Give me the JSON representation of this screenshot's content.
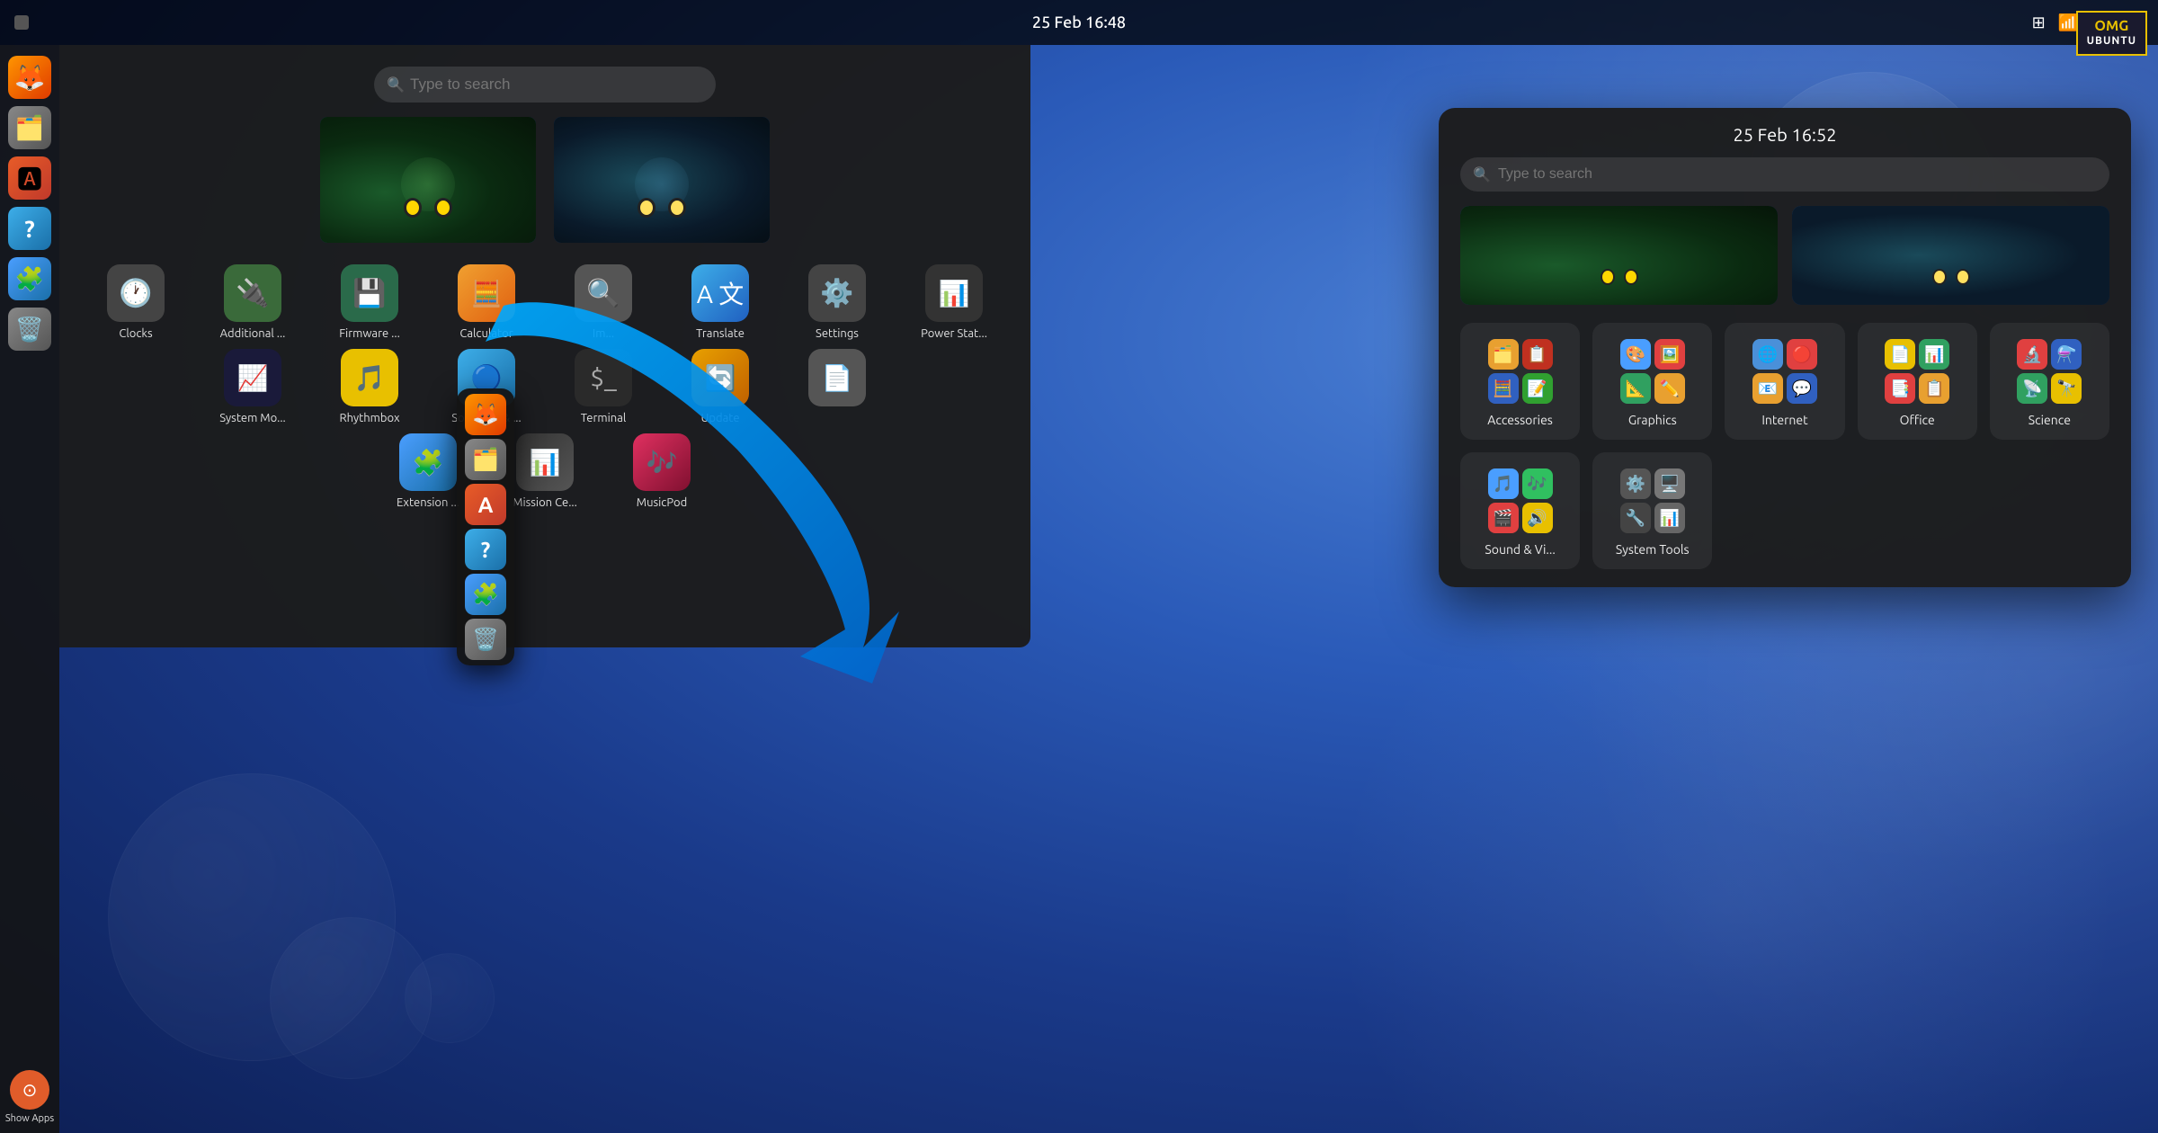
{
  "desktop": {
    "bg_color": "#1a3a8a"
  },
  "topbar": {
    "datetime_left": "25 Feb  16:48",
    "datetime_right": "25 Feb  16:52",
    "icons": [
      "grid-icon",
      "wifi-icon",
      "volume-icon",
      "battery-icon"
    ]
  },
  "omg": {
    "line1": "OMG",
    "line2": "UBUNTU"
  },
  "dock": {
    "items": [
      {
        "name": "firefox",
        "label": "Firefox"
      },
      {
        "name": "files",
        "label": "Files"
      },
      {
        "name": "app-center",
        "label": "App Center"
      },
      {
        "name": "help",
        "label": "Help"
      },
      {
        "name": "extensions",
        "label": "Extensions"
      },
      {
        "name": "trash",
        "label": "Trash"
      }
    ],
    "show_apps_label": "Show Apps"
  },
  "left_panel": {
    "search_placeholder": "Type to search",
    "apps": [
      [
        {
          "label": "Clocks",
          "icon": "🕐"
        },
        {
          "label": "Additional ...",
          "icon": "🔌"
        },
        {
          "label": "Firmware ...",
          "icon": "💾"
        },
        {
          "label": "Calculator",
          "icon": "🧮"
        },
        {
          "label": "Im...",
          "icon": "🔍"
        },
        {
          "label": "Translate",
          "icon": "🌐"
        },
        {
          "label": "Settings",
          "icon": "⚙️"
        },
        {
          "label": "Power Stat...",
          "icon": "📊"
        }
      ],
      [
        {
          "label": "System Mo...",
          "icon": "📈"
        },
        {
          "label": "Rhythmbox",
          "icon": "🎵"
        },
        {
          "label": "Software & ...",
          "icon": "🔵"
        },
        {
          "label": "Terminal",
          "icon": "💻"
        },
        {
          "label": "Update",
          "icon": "🔄"
        },
        {
          "label": "",
          "icon": "📄"
        }
      ],
      [
        {
          "label": "Extension ...",
          "icon": "🧩"
        },
        {
          "label": "Mission Ce...",
          "icon": "📊"
        },
        {
          "label": "MusicPod",
          "icon": "🎶"
        }
      ]
    ]
  },
  "right_panel": {
    "time": "25 Feb  16:52",
    "search_placeholder": "Type to search",
    "categories": [
      {
        "label": "Accessories"
      },
      {
        "label": "Graphics"
      },
      {
        "label": "Internet"
      },
      {
        "label": "Office"
      },
      {
        "label": "Science"
      },
      {
        "label": "Sound & Vi..."
      },
      {
        "label": "System Tools"
      }
    ]
  },
  "mini_dock": {
    "items": [
      "firefox",
      "files",
      "app-center",
      "help",
      "extensions",
      "trash"
    ]
  }
}
